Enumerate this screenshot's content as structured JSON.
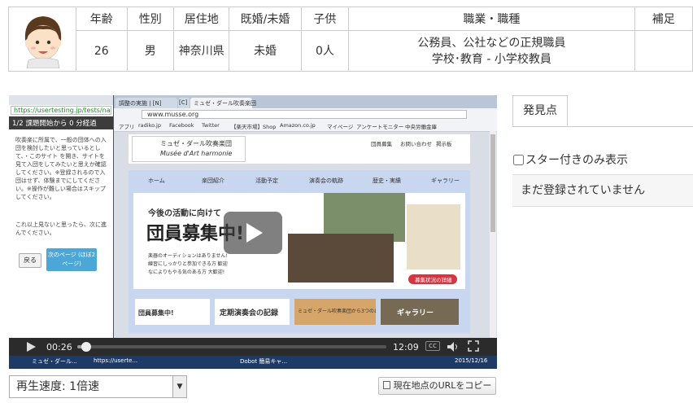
{
  "profile": {
    "headers": [
      "年齢",
      "性別",
      "居住地",
      "既婚/未婚",
      "子供",
      "職業・職種",
      "補足"
    ],
    "values": {
      "age": "26",
      "gender": "男",
      "residence": "神奈川県",
      "marital": "未婚",
      "children": "0人",
      "occupation_line1": "公務員、公社などの正規職員",
      "occupation_line2": "学校･教育 - 小学校教員",
      "note": ""
    }
  },
  "player": {
    "left_panel": {
      "url": "https://usertesting.jp/tests/nav",
      "task_header": "1/2 課題開始から 0 分経過",
      "instruction": "吹奏楽に所属で、一般の団体への入団を検討したいと思っているとして、・このサイト を開き、サイトを見て入団をしてみたいと思えか確認してください。※登録されるので入団はせず、体験までにしてください。※操作が難しい場合はスキップしてください。",
      "no_match": "これ以上見ないと思ったら、次に進んでください。",
      "back_label": "戻る",
      "next_label": "次のページ (ほぼ2ページ)"
    },
    "site": {
      "tab_labels": [
        "調整の実施 | [N]",
        "[C]",
        "ミュゼ・ダール吹奏楽団"
      ],
      "url": "www.musse.org",
      "bookmarks": [
        "アプリ",
        "radiko.jp",
        "Facebook",
        "Twitter",
        "【楽天市場】Shop",
        "Amazon.co.jp",
        "マイページ",
        "アンケートモニター",
        "中央労働金庫"
      ],
      "logo_text": "ミュゼ・ダール吹奏楽団",
      "logo_sub": "Musée d'Art harmonie",
      "top_links": [
        "団員募集",
        "お問い合わせ",
        "掲示板"
      ],
      "nav_items": [
        "ホーム",
        "楽団紹介",
        "活動予定",
        "演奏会の軌跡",
        "歴史・実績",
        "ギャラリー"
      ],
      "hero_small": "今後の活動に向けて",
      "hero_big": "団員募集中!",
      "hero_bullets": [
        "楽器のオーディションはありません!",
        "練習にしっかりと参加できる方 歓迎",
        "なによりもやる気のある方 大歓迎!"
      ],
      "hero_button": "募集状況の詳細",
      "banners": [
        "団員募集中!",
        "定期演奏会の記録",
        "ミュゼ・ダール吹奏楽団から3つのお知らせ!",
        "ギャラリー"
      ]
    },
    "controls": {
      "current_time": "00:26",
      "total_time": "12:09",
      "progress_fraction": 0.03,
      "cc_label": "cc"
    },
    "taskbar": {
      "items": [
        "ミュゼ・ダール...",
        "https://userte...",
        "Dobot 簡易キャ..."
      ],
      "date": "2015/12/16"
    }
  },
  "findings": {
    "tab_label": "発見点",
    "star_filter_label": "スター付きのみ表示",
    "empty_message": "まだ登録されていません"
  },
  "speed": {
    "selected": "再生速度: 1倍速"
  },
  "copy_url_button": "現在地点のURLをコピー"
}
